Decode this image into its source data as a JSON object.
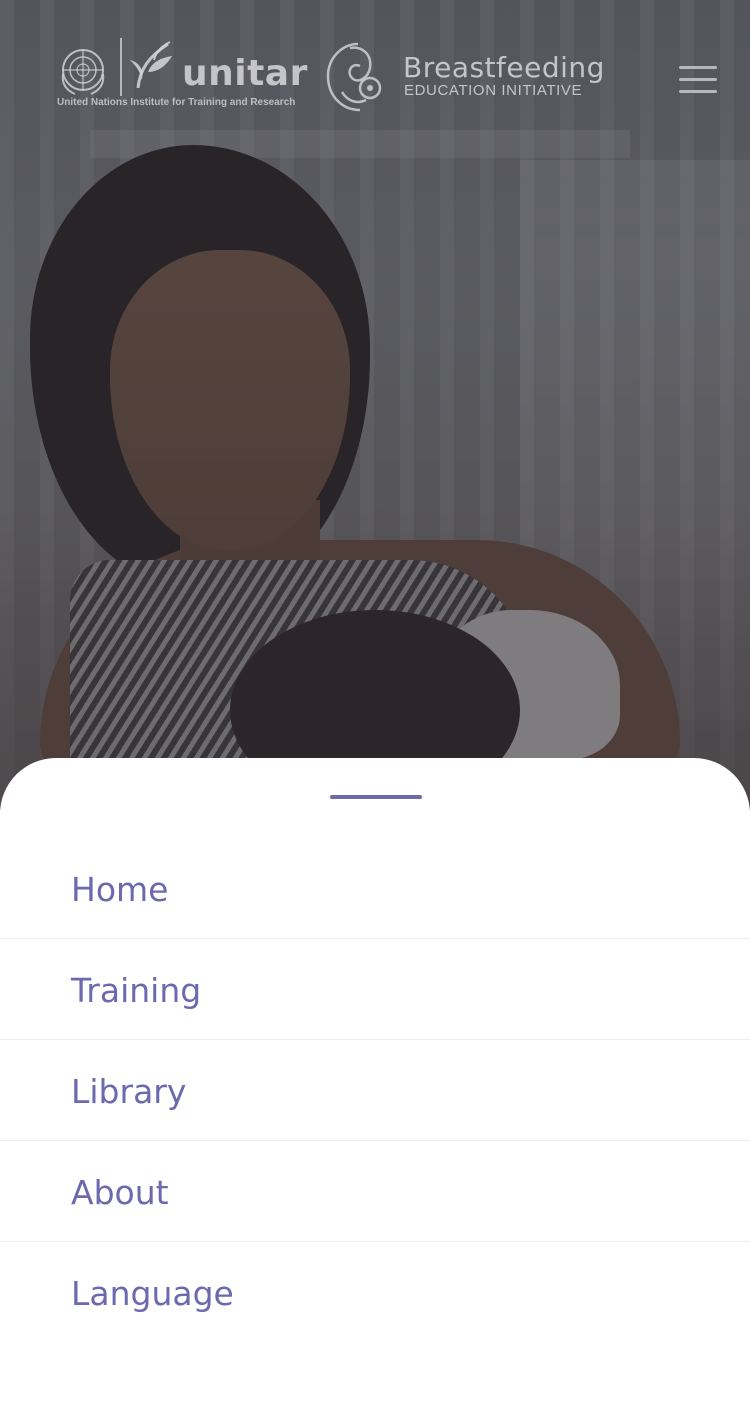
{
  "header": {
    "unitar_wordmark": "unitar",
    "unitar_tagline": "United Nations Institute for Training and Research",
    "bf_title": "Breastfeeding",
    "bf_subtitle": "EDUCATION INITIATIVE",
    "menu_icon": "hamburger-menu-icon"
  },
  "hero": {
    "image": "mother-breastfeeding-baby-photo"
  },
  "menu": {
    "items": [
      {
        "label": "Home"
      },
      {
        "label": "Training"
      },
      {
        "label": "Library"
      },
      {
        "label": "About"
      },
      {
        "label": "Language"
      }
    ]
  },
  "colors": {
    "accent": "#6c69ae",
    "divider": "#ececf1",
    "overlay_text": "#d7d7dc"
  }
}
